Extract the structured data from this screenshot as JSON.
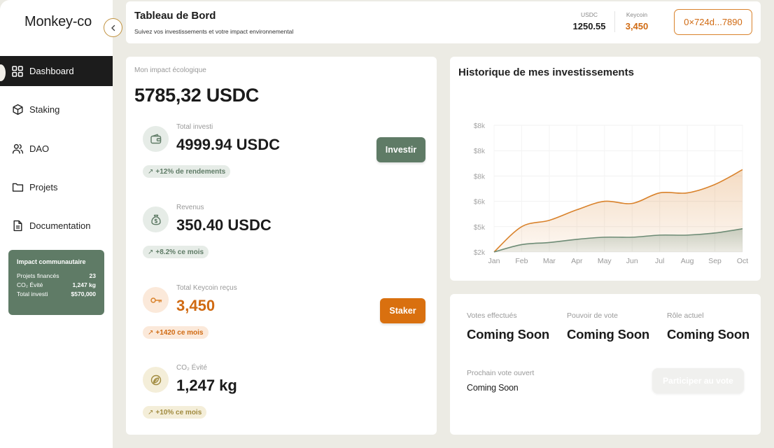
{
  "app": {
    "logo": "Monkey-co"
  },
  "sidebar": {
    "items": [
      {
        "label": "Dashboard",
        "icon": "grid-icon",
        "active": true
      },
      {
        "label": "Staking",
        "icon": "cube-icon"
      },
      {
        "label": "DAO",
        "icon": "users-icon"
      },
      {
        "label": "Projets",
        "icon": "folder-icon"
      },
      {
        "label": "Documentation",
        "icon": "document-icon"
      }
    ],
    "impact_card": {
      "title": "Impact communautaire",
      "rows": [
        {
          "label": "Projets financés",
          "value": "23"
        },
        {
          "label": "CO₂ Évité",
          "value": "1,247 kg"
        },
        {
          "label": "Total investi",
          "value": "$570,000"
        }
      ]
    }
  },
  "header": {
    "title": "Tableau de Bord",
    "subtitle": "Suivez vos investissements et votre impact environnemental",
    "usdc_label": "USDC",
    "usdc_value": "1250.55",
    "keycoin_label": "Keycoin",
    "keycoin_value": "3,450",
    "wallet": "0×724d...7890"
  },
  "impact": {
    "label": "Mon impact écologique",
    "total": "5785,32 USDC",
    "stats": [
      {
        "label": "Total investi",
        "value": "4999.94 USDC",
        "pill": "+12% de rendements",
        "icon": "wallet-icon",
        "button": "Investir"
      },
      {
        "label": "Revenus",
        "value": "350.40 USDC",
        "pill": "+8.2% ce mois",
        "icon": "money-bag-icon"
      },
      {
        "label": "Total Keycoin reçus",
        "value": "3,450",
        "pill": "+1420 ce mois",
        "icon": "key-icon",
        "button": "Staker"
      },
      {
        "label": "CO₂ Évité",
        "value": "1,247 kg",
        "pill": "+10% ce mois",
        "icon": "leaf-icon"
      }
    ]
  },
  "colors": {
    "accent": "#d9822b",
    "green": "#5f7b66",
    "dark": "#1c1c1c"
  },
  "chart_data": {
    "type": "area",
    "title": "Historique de mes investissements",
    "categories": [
      "Jan",
      "Feb",
      "Mar",
      "Apr",
      "May",
      "Jun",
      "Jul",
      "Aug",
      "Sep",
      "Oct"
    ],
    "y_tick_labels": [
      "$2k",
      "$5k",
      "$6k",
      "$8k",
      "$8k",
      "$8k"
    ],
    "ylim": [
      0,
      6
    ],
    "grid": true,
    "legend": "none",
    "series": [
      {
        "color": "#d9822b",
        "values": [
          0,
          1.2,
          1.5,
          2.0,
          2.4,
          2.3,
          2.8,
          2.8,
          3.2,
          3.9
        ]
      },
      {
        "color": "#6e8c76",
        "values": [
          0,
          0.35,
          0.45,
          0.6,
          0.7,
          0.7,
          0.8,
          0.8,
          0.9,
          1.1
        ]
      }
    ]
  },
  "dao": {
    "stats": [
      {
        "label": "Votes effectués",
        "value": "Coming Soon"
      },
      {
        "label": "Pouvoir de vote",
        "value": "Coming Soon"
      },
      {
        "label": "Rôle actuel",
        "value": "Coming Soon"
      }
    ],
    "next_vote_label": "Prochain vote ouvert",
    "next_vote_value": "Coming Soon",
    "button": "Participer au vote"
  }
}
